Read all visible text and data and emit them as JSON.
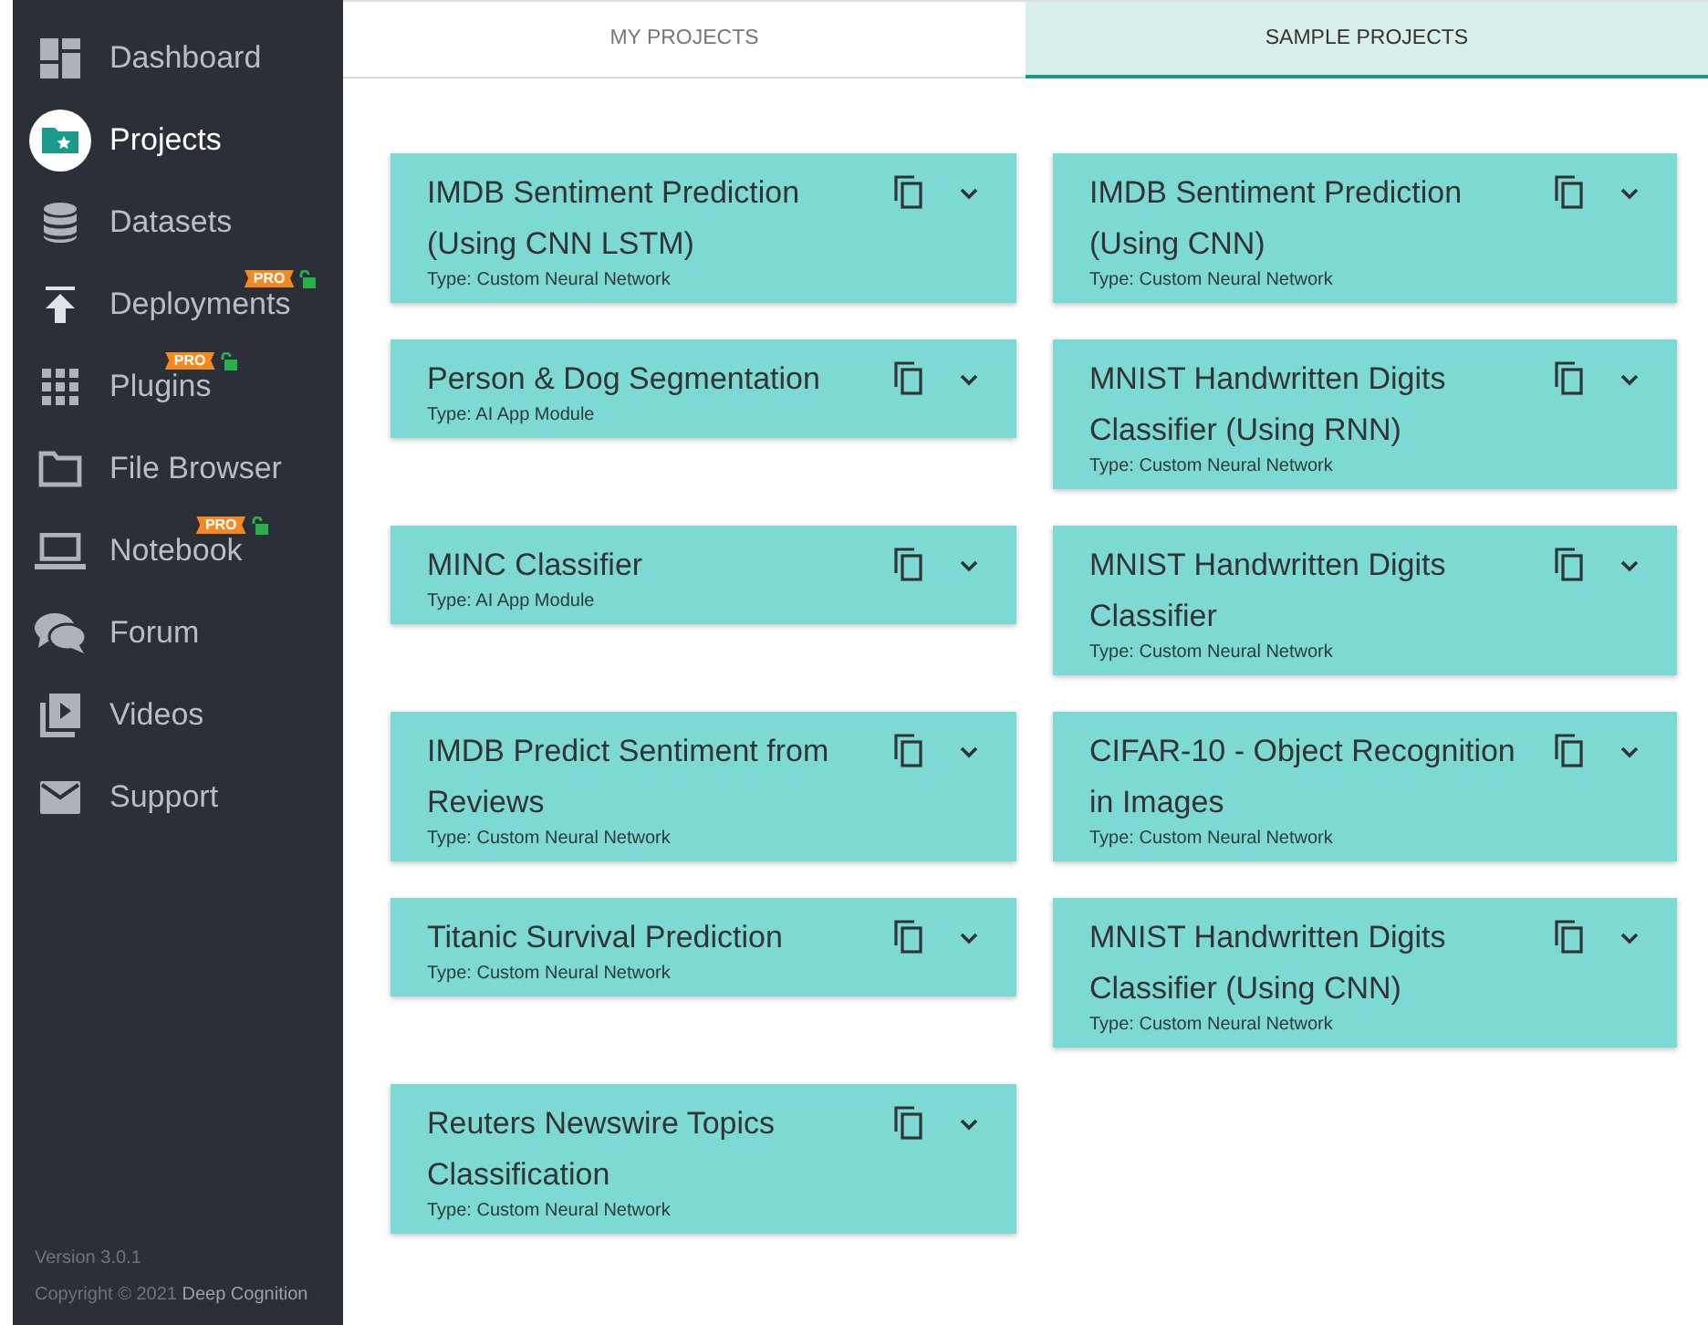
{
  "sidebar": {
    "items": [
      {
        "label": "Dashboard",
        "selected": false
      },
      {
        "label": "Projects",
        "selected": true
      },
      {
        "label": "Datasets",
        "selected": false
      },
      {
        "label": "Deployments",
        "selected": false,
        "badge": "PRO"
      },
      {
        "label": "Plugins",
        "selected": false,
        "badge": "PRO"
      },
      {
        "label": "File Browser",
        "selected": false
      },
      {
        "label": "Notebook",
        "selected": false,
        "badge": "PRO"
      },
      {
        "label": "Forum",
        "selected": false
      },
      {
        "label": "Videos",
        "selected": false
      },
      {
        "label": "Support",
        "selected": false
      }
    ],
    "version": "Version 3.0.1",
    "copyright": "Copyright © 2021",
    "company": "Deep Cognition"
  },
  "tabs": [
    {
      "label": "MY PROJECTS",
      "selected": false
    },
    {
      "label": "SAMPLE PROJECTS",
      "selected": true
    }
  ],
  "projects": [
    {
      "title": "IMDB Sentiment Prediction (Using CNN LSTM)",
      "type": "Type: Custom Neural Network"
    },
    {
      "title": "IMDB Sentiment Prediction (Using CNN)",
      "type": "Type: Custom Neural Network"
    },
    {
      "title": "Person & Dog Segmentation",
      "type": "Type: AI App Module"
    },
    {
      "title": "MNIST Handwritten Digits Classifier (Using RNN)",
      "type": "Type: Custom Neural Network"
    },
    {
      "title": "MINC Classifier",
      "type": "Type: AI App Module"
    },
    {
      "title": "MNIST Handwritten Digits Classifier",
      "type": "Type: Custom Neural Network"
    },
    {
      "title": "IMDB Predict Sentiment from Reviews",
      "type": "Type: Custom Neural Network"
    },
    {
      "title": "CIFAR-10 - Object Recognition in Images",
      "type": "Type: Custom Neural Network"
    },
    {
      "title": "Titanic Survival Prediction",
      "type": "Type: Custom Neural Network"
    },
    {
      "title": "MNIST Handwritten Digits Classifier (Using CNN)",
      "type": "Type: Custom Neural Network"
    },
    {
      "title": "Reuters Newswire Topics Classification",
      "type": "Type: Custom Neural Network"
    }
  ]
}
